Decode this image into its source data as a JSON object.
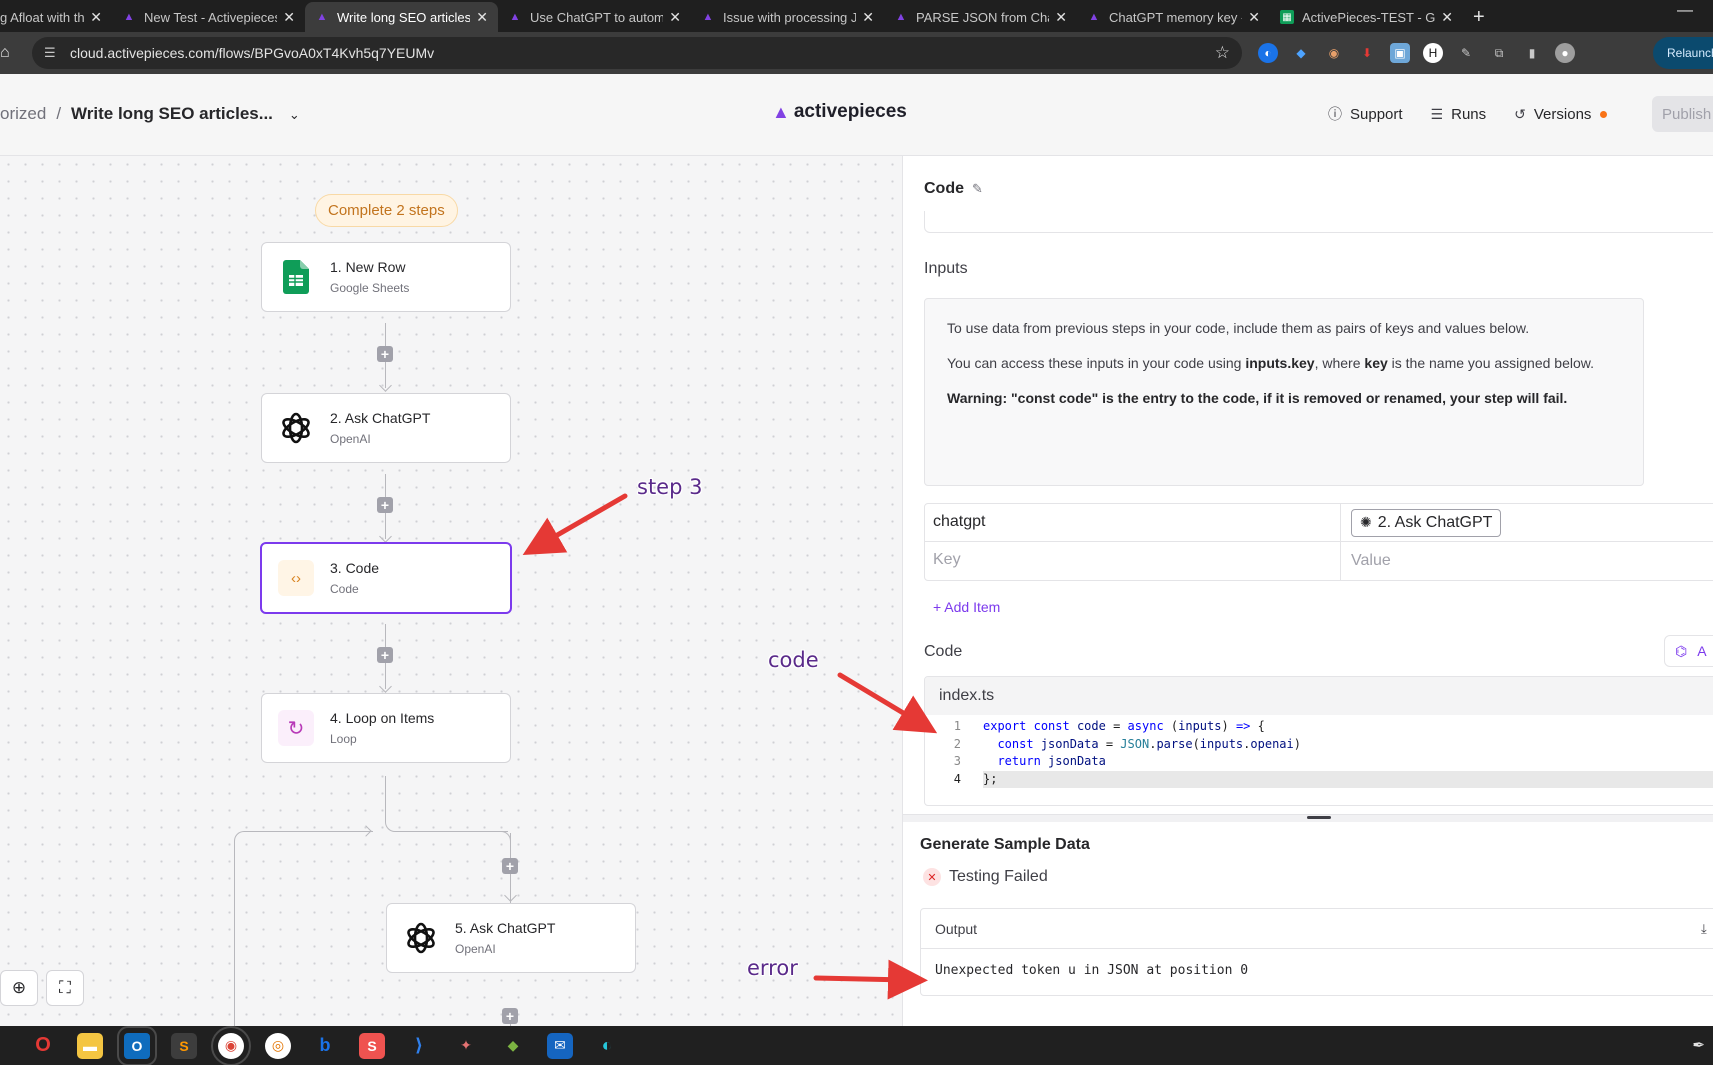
{
  "browser": {
    "tabs": [
      {
        "title": "g Afloat with the",
        "favicon": "ap",
        "active": false
      },
      {
        "title": "New Test - Activepieces",
        "favicon": "ap",
        "active": false
      },
      {
        "title": "Write long SEO articles by",
        "favicon": "ap",
        "active": true
      },
      {
        "title": "Use ChatGPT to automate",
        "favicon": "ap",
        "active": false
      },
      {
        "title": "Issue with processing JSO",
        "favicon": "ap",
        "active": false
      },
      {
        "title": "PARSE JSON from ChatGP",
        "favicon": "ap",
        "active": false
      },
      {
        "title": "ChatGPT memory key - C",
        "favicon": "ap",
        "active": false
      },
      {
        "title": "ActivePieces-TEST - Goog",
        "favicon": "gs",
        "active": false
      }
    ],
    "url": "cloud.activepieces.com/flows/BPGvoA0xT4Kvh5q7YEUMv",
    "relaunch_label": "Relaunch t"
  },
  "header": {
    "breadcrumb_folder": "orized",
    "flow_name": "Write long SEO articles...",
    "brand": "activepieces",
    "support_label": "Support",
    "runs_label": "Runs",
    "versions_label": "Versions",
    "publish_label": "Publish",
    "accent_color": "#8142e3"
  },
  "canvas": {
    "status_badge": "Complete 2 steps",
    "steps": [
      {
        "title": "1. New Row",
        "subtitle": "Google Sheets",
        "icon": "google-sheets-icon"
      },
      {
        "title": "2. Ask ChatGPT",
        "subtitle": "OpenAI",
        "icon": "openai-icon"
      },
      {
        "title": "3. Code",
        "subtitle": "Code",
        "icon": "code-icon",
        "selected": true
      },
      {
        "title": "4. Loop on Items",
        "subtitle": "Loop",
        "icon": "loop-icon"
      },
      {
        "title": "5. Ask ChatGPT",
        "subtitle": "OpenAI",
        "icon": "openai-icon"
      }
    ]
  },
  "panel": {
    "title": "Code",
    "inputs_label": "Inputs",
    "info_line1": "To use data from previous steps in your code, include them as pairs of keys and values below.",
    "info_line2_a": "You can access these inputs in your code using ",
    "info_line2_b": "inputs.key",
    "info_line2_c": ", where ",
    "info_line2_d": "key",
    "info_line2_e": " is the name you assigned below.",
    "info_warning": "Warning: \"const code\" is the entry to the code, if it is removed or renamed, your step will fail.",
    "kv_rows": [
      {
        "key": "chatgpt",
        "value": "2. Ask ChatGPT"
      }
    ],
    "key_placeholder": "Key",
    "value_placeholder": "Value",
    "add_item_label": "+ Add Item",
    "code_label": "Code",
    "ai_button_label": "A",
    "editor_filename": "index.ts",
    "line_numbers": [
      "1",
      "2",
      "3",
      "4"
    ],
    "generate_title": "Generate Sample Data",
    "test_status": "Testing Failed",
    "output_label": "Output",
    "output_text": "Unexpected token u in JSON at position 0"
  },
  "annotations": {
    "step3": "step 3",
    "code": "code",
    "error": "error",
    "color": "#e53935"
  }
}
